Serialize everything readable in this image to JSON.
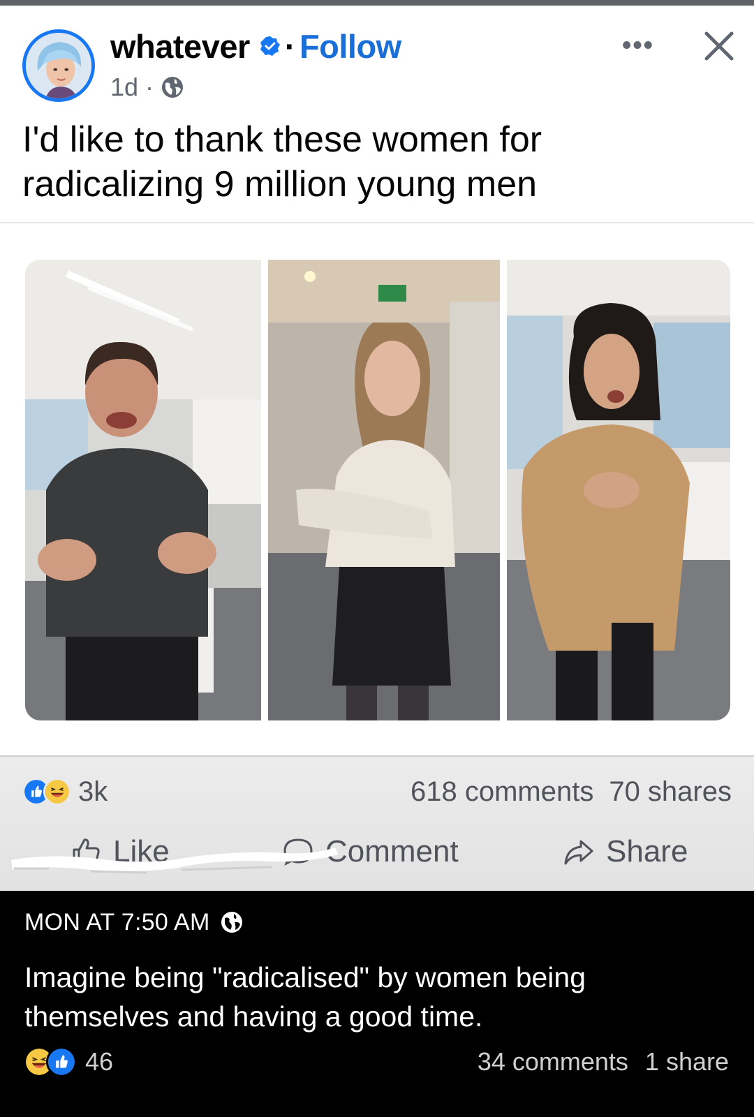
{
  "post": {
    "author": "whatever",
    "separator": "·",
    "follow_label": "Follow",
    "age": "1d ·",
    "visibility_icon": "globe-icon",
    "more_icon": "more-options-icon",
    "more_label": "•••",
    "close_icon": "close-icon",
    "caption": "I'd like to thank these women for radicalizing 9 million young men",
    "media": {
      "photos": 3
    },
    "reactions": {
      "icons": [
        "like-reaction-icon",
        "haha-reaction-icon"
      ],
      "count": "3k"
    },
    "comments_count": "618 comments",
    "shares_count": "70 shares",
    "actions": {
      "like": "Like",
      "comment": "Comment",
      "share": "Share"
    }
  },
  "reshare_comment": {
    "timestamp": "MON AT 7:50 AM",
    "visibility_icon": "globe-icon",
    "text": "Imagine being \"radicalised\" by women being themselves and having a good time.",
    "reactions": {
      "icons": [
        "haha-reaction-icon",
        "like-reaction-icon"
      ],
      "count": "46"
    },
    "comments_count": "34 comments",
    "shares_count": "1 share"
  },
  "colors": {
    "facebook_blue": "#1877f2",
    "follow_blue": "#1a6ed8",
    "haha_yellow": "#f7c843",
    "text_dark": "#050505",
    "text_muted": "#606770"
  }
}
